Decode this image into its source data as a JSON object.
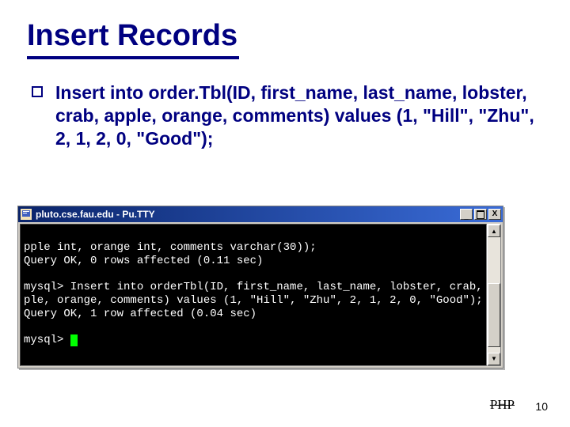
{
  "slide": {
    "title": "Insert Records",
    "bullet_text": "Insert into order.Tbl(ID, first_name, last_name, lobster, crab, apple, orange, comments) values (1, \"Hill\", \"Zhu\", 2, 1, 2, 0, \"Good\");"
  },
  "window": {
    "title": "pluto.cse.fau.edu - Pu.TTY",
    "buttons": {
      "min": "_",
      "max": "",
      "close": "X"
    }
  },
  "terminal": {
    "lines": [
      "pple int, orange int, comments varchar(30));",
      "Query OK, 0 rows affected (0.11 sec)",
      "",
      "mysql> Insert into orderTbl(ID, first_name, last_name, lobster, crab, ap",
      "ple, orange, comments) values (1, \"Hill\", \"Zhu\", 2, 1, 2, 0, \"Good\");",
      "Query OK, 1 row affected (0.04 sec)",
      "",
      "mysql> "
    ]
  },
  "scrollbar": {
    "up": "▲",
    "down": "▼"
  },
  "footer": {
    "label": "PHP",
    "page": "10"
  }
}
